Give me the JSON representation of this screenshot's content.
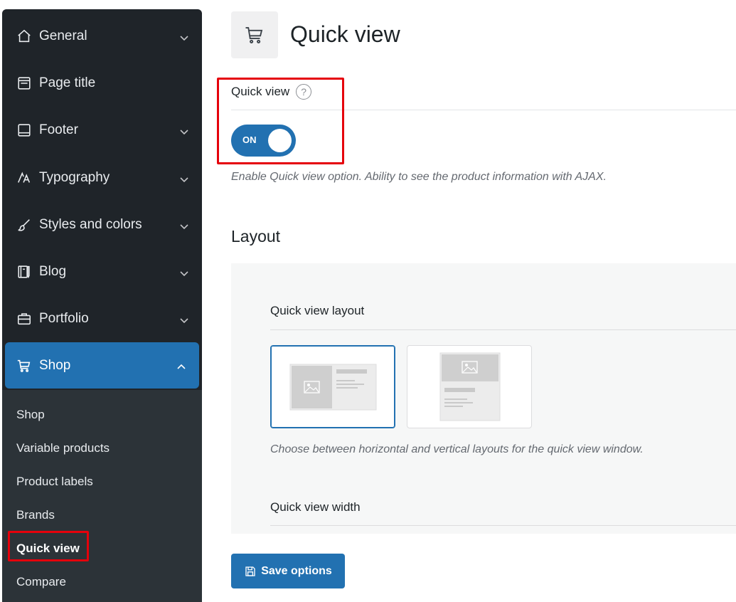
{
  "sidebar": {
    "items": [
      {
        "label": "General",
        "icon": "home-icon",
        "has_chevron": true
      },
      {
        "label": "Page title",
        "icon": "page-title-icon",
        "has_chevron": false
      },
      {
        "label": "Footer",
        "icon": "footer-icon",
        "has_chevron": true
      },
      {
        "label": "Typography",
        "icon": "typography-icon",
        "has_chevron": true
      },
      {
        "label": "Styles and colors",
        "icon": "brush-icon",
        "has_chevron": true
      },
      {
        "label": "Blog",
        "icon": "blog-icon",
        "has_chevron": true
      },
      {
        "label": "Portfolio",
        "icon": "briefcase-icon",
        "has_chevron": true
      },
      {
        "label": "Shop",
        "icon": "cart-icon",
        "has_chevron": true,
        "active": true
      }
    ],
    "submenu": [
      {
        "label": "Shop"
      },
      {
        "label": "Variable products"
      },
      {
        "label": "Product labels"
      },
      {
        "label": "Brands"
      },
      {
        "label": "Quick view",
        "current": true
      },
      {
        "label": "Compare"
      }
    ]
  },
  "header": {
    "title": "Quick view",
    "icon": "cart-icon"
  },
  "quick_view_field": {
    "label": "Quick view",
    "help": "?",
    "toggle_label": "ON",
    "toggle_on": true,
    "description": "Enable Quick view option. Ability to see the product information with AJAX."
  },
  "layout_section": {
    "title": "Layout",
    "layout_label": "Quick view layout",
    "options": [
      "horizontal",
      "vertical"
    ],
    "selected": "horizontal",
    "layout_description": "Choose between horizontal and vertical layouts for the quick view window.",
    "width_label": "Quick view width"
  },
  "save_button": {
    "label": "Save options"
  },
  "colors": {
    "accent": "#2271b1",
    "sidebar_bg": "#1f2429",
    "highlight": "#e5000b"
  }
}
